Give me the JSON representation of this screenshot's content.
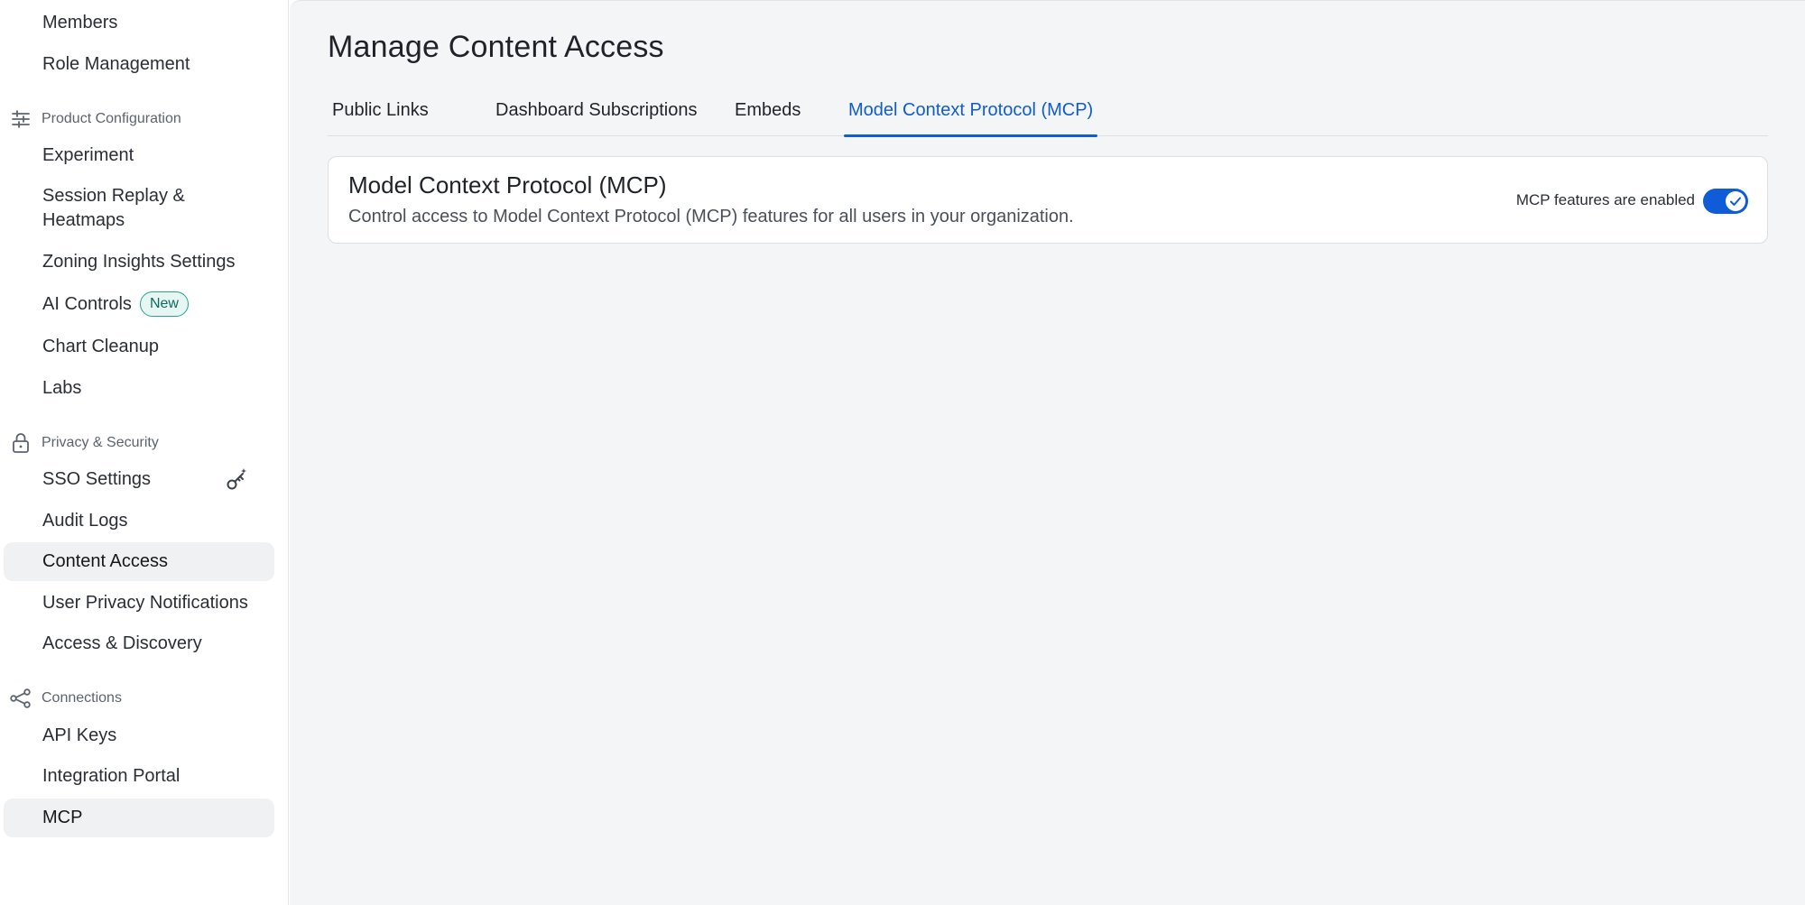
{
  "sidebar": {
    "items_top": [
      {
        "label": "Members"
      },
      {
        "label": "Role Management"
      }
    ],
    "sections": [
      {
        "title": "Product Configuration",
        "icon": "sliders-icon",
        "items": [
          {
            "label": "Experiment"
          },
          {
            "label": "Session Replay &"
          },
          {
            "label": "Heatmaps"
          },
          {
            "label": "Zoning Insights Settings"
          },
          {
            "label": "AI Controls",
            "badge": "New"
          },
          {
            "label": "Chart Cleanup"
          },
          {
            "label": "Labs"
          }
        ]
      },
      {
        "title": "Privacy & Security",
        "icon": "lock-icon",
        "items": [
          {
            "label": "SSO Settings"
          },
          {
            "label": "Audit Logs"
          },
          {
            "label": "Content Access"
          },
          {
            "label": "User Privacy Notifications"
          },
          {
            "label": "Access & Discovery"
          }
        ]
      },
      {
        "title": "Connections",
        "icon": "connections-icon",
        "items": [
          {
            "label": "API Keys"
          },
          {
            "label": "Integration Portal"
          },
          {
            "label": "MCP"
          }
        ]
      }
    ]
  },
  "main": {
    "title": "Manage Content Access",
    "tabs": [
      {
        "label": "Public Links"
      },
      {
        "label": "Dashboard Subscriptions"
      },
      {
        "label": "Embeds"
      },
      {
        "label": "Model Context Protocol (MCP)"
      }
    ],
    "active_tab": "Model Context Protocol (MCP)",
    "card": {
      "title": "Model Context Protocol (MCP)",
      "description": "Control access to Model Context Protocol (MCP) features for all users in your organization.",
      "toggle_label": "MCP features are enabled",
      "toggle_on": true
    }
  },
  "colors": {
    "accent": "#0f5bd8",
    "badge_border": "#28a48c",
    "badge_text": "#0d6b5c",
    "main_bg": "#f4f5f7"
  }
}
